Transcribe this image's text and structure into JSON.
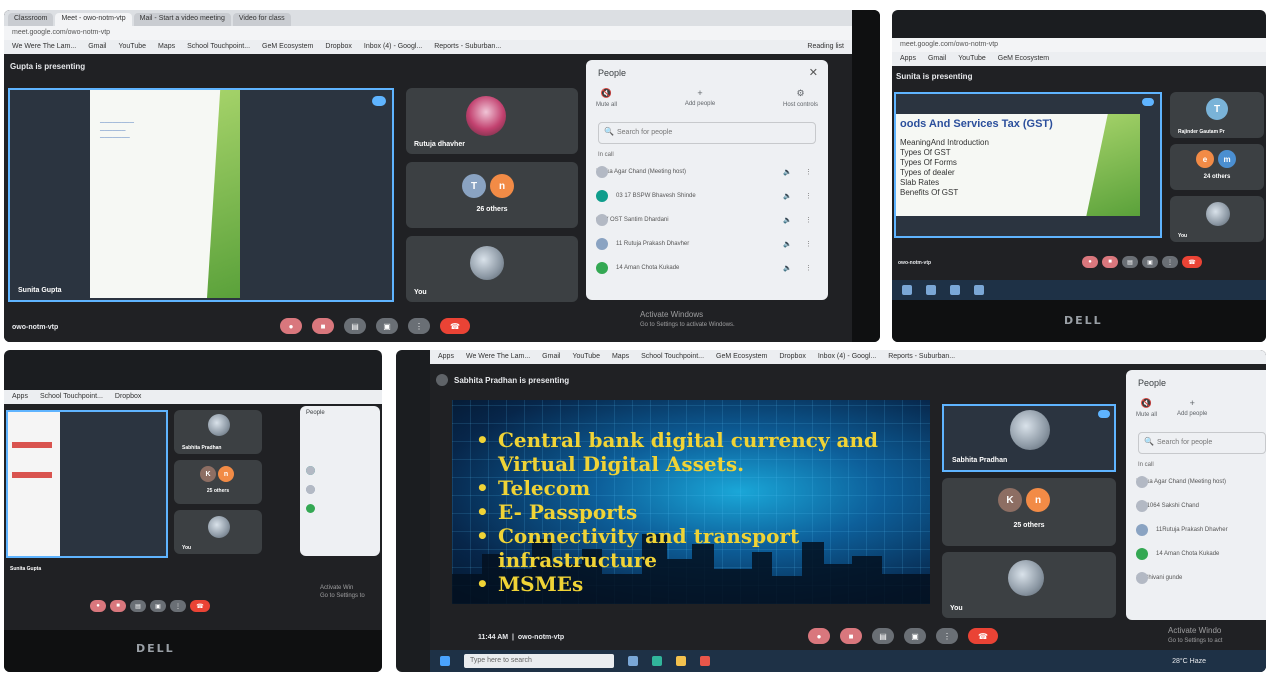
{
  "browser": {
    "tabs": [
      "Classroom",
      "Meet - owo-notm-vtp",
      "Mail - Start a video meeting",
      "Video for class"
    ],
    "url": "meet.google.com/owo-notm-vtp",
    "bookmarks": [
      "Apps",
      "We Were The Lam...",
      "Gmail",
      "YouTube",
      "Maps",
      "School Touchpoint...",
      "GeM Ecosystem",
      "Dropbox",
      "Inbox (4) - Googl...",
      "Reports - Suburban..."
    ],
    "reading_list": "Reading list"
  },
  "photo1": {
    "presenting": "Gupta is presenting",
    "presenter_name": "Sunita Gupta",
    "tiles": [
      {
        "name": "Rutuja dhavher"
      },
      {
        "name": "26 others",
        "initials": [
          "T",
          "n"
        ]
      },
      {
        "name": "You"
      }
    ],
    "meeting_code": "owo-notm-vtp",
    "watermark": [
      "Activate Windows",
      "Go to Settings to activate Windows."
    ],
    "people": {
      "title": "People",
      "actions": [
        "Mute all",
        "Add people",
        "Host controls"
      ],
      "search_placeholder": "Search for people",
      "section": "In call",
      "rows": [
        "Pritika Agar Chand (Meeting host)",
        "03 17 BSPW Bhavesh Shinde",
        "04 V OST Santim Dhardani",
        "11 Rutuja Prakash Dhavher",
        "14 Aman Chota Kukade"
      ]
    }
  },
  "photo2": {
    "presenting": "Sunita is presenting",
    "slide_title": "oods And Services Tax (GST)",
    "slide_points": [
      "MeaningAnd Introduction",
      "Types Of GST",
      "Types Of Forms",
      "Types of dealer",
      "Slab Rates",
      "Benefits Of GST"
    ],
    "tiles": [
      {
        "name": "Rajinder Gautam Pr"
      },
      {
        "name": "24 others",
        "initials": [
          "e",
          "m"
        ]
      },
      {
        "name": "You"
      }
    ],
    "meeting_code": "owo-notm-vtp",
    "brand": "DELL"
  },
  "photo3": {
    "presenting": "Sunita Gupta",
    "tiles": [
      {
        "name": "Sabhita Pradhan"
      },
      {
        "name": "25 others",
        "initials": [
          "K",
          "n"
        ]
      },
      {
        "name": "You"
      }
    ],
    "people_title": "People",
    "watermark": [
      "Activate Win",
      "Go to Settings to"
    ],
    "brand": "DELL"
  },
  "photo4": {
    "presenting": "Sabhita Pradhan is presenting",
    "slide_points": [
      "Central bank digital currency and Virtual Digital Assets.",
      "Telecom",
      "E- Passports",
      "Connectivity and transport infrastructure",
      "MSMEs"
    ],
    "tiles": [
      {
        "name": "Sabhita Pradhan"
      },
      {
        "name": "25 others",
        "initials": [
          "K",
          "n"
        ]
      },
      {
        "name": "You"
      }
    ],
    "time": "11:44 AM",
    "meeting_code": "owo-notm-vtp",
    "people": {
      "title": "People",
      "actions": [
        "Mute all",
        "Add people"
      ],
      "search_placeholder": "Search for people",
      "section": "In call",
      "rows": [
        "Pritika Agar Chand (Meeting host)",
        "Ar 11064 Sakshi Chand",
        "11Rutuja Prakash Dhavher",
        "14 Aman Chota Kukade",
        "16 Shivani gunde"
      ]
    },
    "taskbar_search": "Type here to search",
    "weather": "28°C Haze",
    "watermark": [
      "Activate Windo",
      "Go to Settings to act"
    ],
    "brand": "DELL"
  }
}
